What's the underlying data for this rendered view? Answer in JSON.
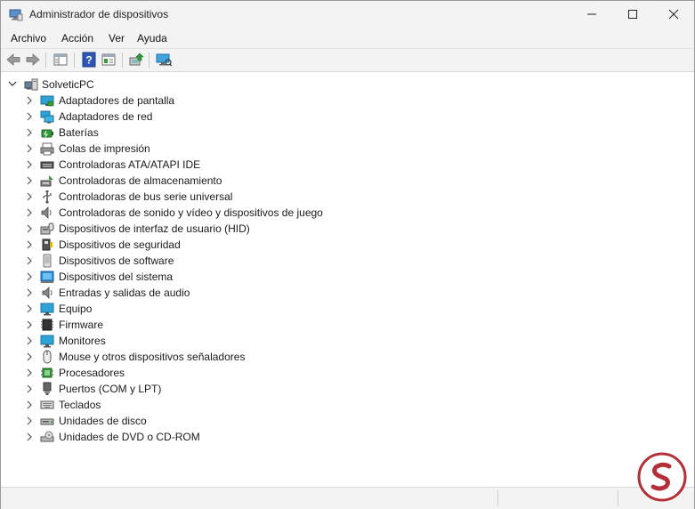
{
  "window": {
    "title": "Administrador de dispositivos",
    "controls": [
      "minimize-icon",
      "maximize-icon",
      "close-icon"
    ]
  },
  "menu": [
    "Archivo",
    "Acción",
    "Ver",
    "Ayuda"
  ],
  "toolbar": {
    "buttons": [
      "back-icon",
      "forward-icon",
      "show-hide-console-tree-icon",
      "help-icon",
      "properties-icon",
      "update-driver-icon",
      "scan-hardware-icon"
    ]
  },
  "tree": {
    "root": "SolveticPC",
    "categories": [
      {
        "label": "Adaptadores de pantalla",
        "icon": "display-adapter-icon"
      },
      {
        "label": "Adaptadores de red",
        "icon": "network-adapter-icon"
      },
      {
        "label": "Baterías",
        "icon": "battery-icon"
      },
      {
        "label": "Colas de impresión",
        "icon": "print-queue-icon"
      },
      {
        "label": "Controladoras ATA/ATAPI IDE",
        "icon": "ide-controller-icon"
      },
      {
        "label": "Controladoras de almacenamiento",
        "icon": "storage-controller-icon"
      },
      {
        "label": "Controladoras de bus serie universal",
        "icon": "usb-icon"
      },
      {
        "label": "Controladoras de sonido y vídeo y dispositivos de juego",
        "icon": "sound-icon"
      },
      {
        "label": "Dispositivos de interfaz de usuario (HID)",
        "icon": "hid-icon"
      },
      {
        "label": "Dispositivos de seguridad",
        "icon": "security-device-icon"
      },
      {
        "label": "Dispositivos de software",
        "icon": "software-device-icon"
      },
      {
        "label": "Dispositivos del sistema",
        "icon": "system-device-icon"
      },
      {
        "label": "Entradas y salidas de audio",
        "icon": "audio-io-icon"
      },
      {
        "label": "Equipo",
        "icon": "computer-icon"
      },
      {
        "label": "Firmware",
        "icon": "firmware-icon"
      },
      {
        "label": "Monitores",
        "icon": "monitor-icon"
      },
      {
        "label": "Mouse y otros dispositivos señaladores",
        "icon": "mouse-icon"
      },
      {
        "label": "Procesadores",
        "icon": "processor-icon"
      },
      {
        "label": "Puertos (COM y LPT)",
        "icon": "port-icon"
      },
      {
        "label": "Teclados",
        "icon": "keyboard-icon"
      },
      {
        "label": "Unidades de disco",
        "icon": "disk-drive-icon"
      },
      {
        "label": "Unidades de DVD o CD-ROM",
        "icon": "dvd-drive-icon"
      }
    ]
  },
  "watermark": {
    "icon": "solvetic-logo-icon",
    "color": "#b3303a"
  }
}
